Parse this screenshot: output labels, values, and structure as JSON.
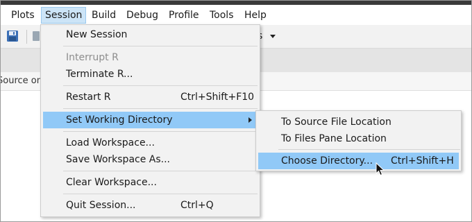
{
  "menubar": {
    "items": [
      "Plots",
      "Session",
      "Build",
      "Debug",
      "Profile",
      "Tools",
      "Help"
    ],
    "open_item": "Session"
  },
  "toolbar": {
    "right_text_fragment": "s"
  },
  "pane": {
    "label_fragment": "Source on"
  },
  "session_menu": {
    "new_session": "New Session",
    "interrupt_r": "Interrupt R",
    "terminate_r": "Terminate R...",
    "restart_r": "Restart R",
    "restart_r_shortcut": "Ctrl+Shift+F10",
    "set_working_directory": "Set Working Directory",
    "load_workspace": "Load Workspace...",
    "save_workspace_as": "Save Workspace As...",
    "clear_workspace": "Clear Workspace...",
    "quit_session": "Quit Session...",
    "quit_session_shortcut": "Ctrl+Q"
  },
  "working_directory_submenu": {
    "to_source_file_location": "To Source File Location",
    "to_files_pane_location": "To Files Pane Location",
    "choose_directory": "Choose Directory...",
    "choose_directory_shortcut": "Ctrl+Shift+H"
  },
  "colors": {
    "menu_highlight": "#91c9f7",
    "menubar_open_bg": "#cce4f7",
    "menu_bg": "#f2f2f2",
    "disabled_text": "#8d8d8d"
  },
  "icons": {
    "save": "save-icon",
    "submenu_arrow": "chevron-right-icon",
    "cursor": "mouse-pointer-icon",
    "dropdown": "chevron-down-icon"
  }
}
